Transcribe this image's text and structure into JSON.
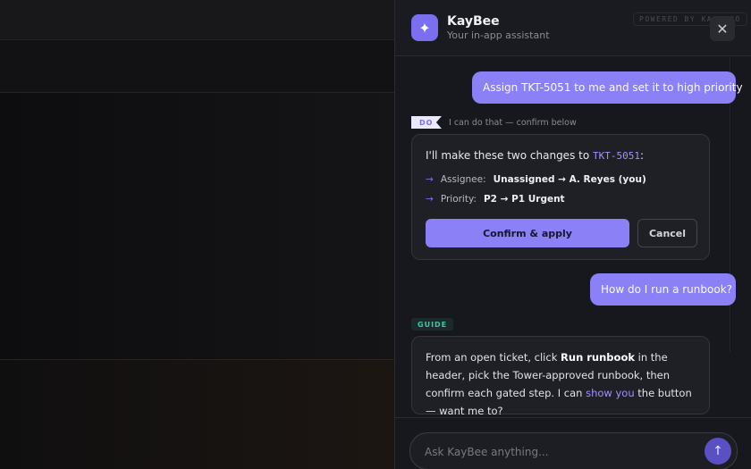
{
  "assistant": {
    "name": "KayBee",
    "subtitle": "Your in-app assistant",
    "powered_by": "POWERED BY KALM CO",
    "close_glyph": "✕",
    "logo_glyph": "✦"
  },
  "messages": {
    "user_1": "Assign TKT-5051 to me and set it to high priority",
    "action": {
      "tag": "DO",
      "note": "I can do that — confirm below",
      "intro_prefix": "I'll make these two changes to ",
      "ticket": "TKT-5051",
      "intro_suffix": ":",
      "changes": [
        {
          "arrow": "→",
          "label": "Assignee:",
          "value": "Unassigned → A. Reyes (you)"
        },
        {
          "arrow": "→",
          "label": "Priority:",
          "value": "P2 → P1 Urgent"
        }
      ],
      "confirm_label": "Confirm & apply",
      "cancel_label": "Cancel"
    },
    "user_2": "How do I run a runbook?",
    "guide": {
      "tag": "GUIDE",
      "text_1": "From an open ticket, click ",
      "bold": "Run runbook",
      "text_2": " in the header, pick the Tower-approved runbook, then confirm each gated step. I can ",
      "link": "show you",
      "text_3": " the button — want me to?"
    }
  },
  "composer": {
    "placeholder": "Ask KayBee anything...",
    "send_glyph": "↑"
  },
  "colors": {
    "accent": "#8b80f5",
    "panel_bg": "#17181d",
    "guide_tag": "#3fc6b0"
  }
}
